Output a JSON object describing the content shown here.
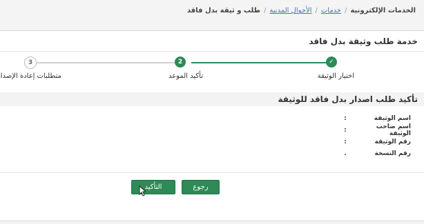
{
  "breadcrumb": {
    "items": [
      "الخدمات الإلكترونية",
      "خدمات",
      "الأحوال المدنية"
    ],
    "current": "طلب و ثيقة بدل فاقد",
    "separator": "/"
  },
  "panel": {
    "title": "خدمة طلب وثيقة بدل فاقد"
  },
  "wizard": {
    "steps": [
      {
        "number": "✓",
        "label": "اختيار الوثيقة",
        "state": "complete"
      },
      {
        "number": "2",
        "label": "تأكيد الموعد",
        "state": "active"
      },
      {
        "number": "3",
        "label": "متطلبات إعادة الإصدار",
        "state": "pending"
      }
    ]
  },
  "confirmation": {
    "title": "تأكيد طلب اصدار بدل فاقد للوثيقة",
    "fields": [
      {
        "label": "اسم الوثيقة",
        "separator": ":"
      },
      {
        "label": "اسم صاحب الوثيقة",
        "separator": ":"
      },
      {
        "label": "رقم الوثيقة",
        "separator": ":"
      },
      {
        "label": "رقم النسخة",
        "separator": "."
      }
    ]
  },
  "actions": {
    "back_label": "رجوع",
    "confirm_label": "التأكيد"
  },
  "colors": {
    "primary": "#2e8a57",
    "link": "#4a74a8",
    "pending": "#cfcfcf"
  }
}
